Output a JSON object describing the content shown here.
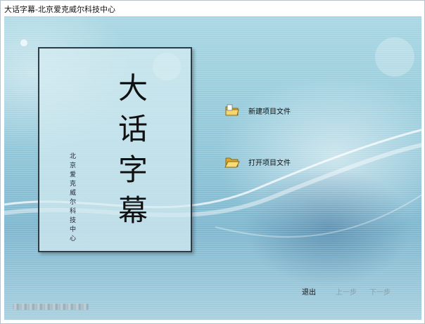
{
  "window": {
    "title": "大话字幕-北京爱克威尔科技中心"
  },
  "panel": {
    "app_name_chars": [
      "大",
      "话",
      "字",
      "幕"
    ],
    "company_chars": [
      "北",
      "京",
      "爱",
      "克",
      "威",
      "尔",
      "科",
      "技",
      "中",
      "心"
    ]
  },
  "menu": {
    "new_project": {
      "label": "新建项目文件",
      "icon": "folder-new-icon"
    },
    "open_project": {
      "label": "打开项目文件",
      "icon": "folder-open-icon"
    }
  },
  "nav": {
    "exit": "退出",
    "prev": "上一步",
    "next": "下一步"
  },
  "colors": {
    "background": "#8fc6d8",
    "panel_border": "#2e3d45",
    "disabled_text": "#8a9ea8"
  }
}
